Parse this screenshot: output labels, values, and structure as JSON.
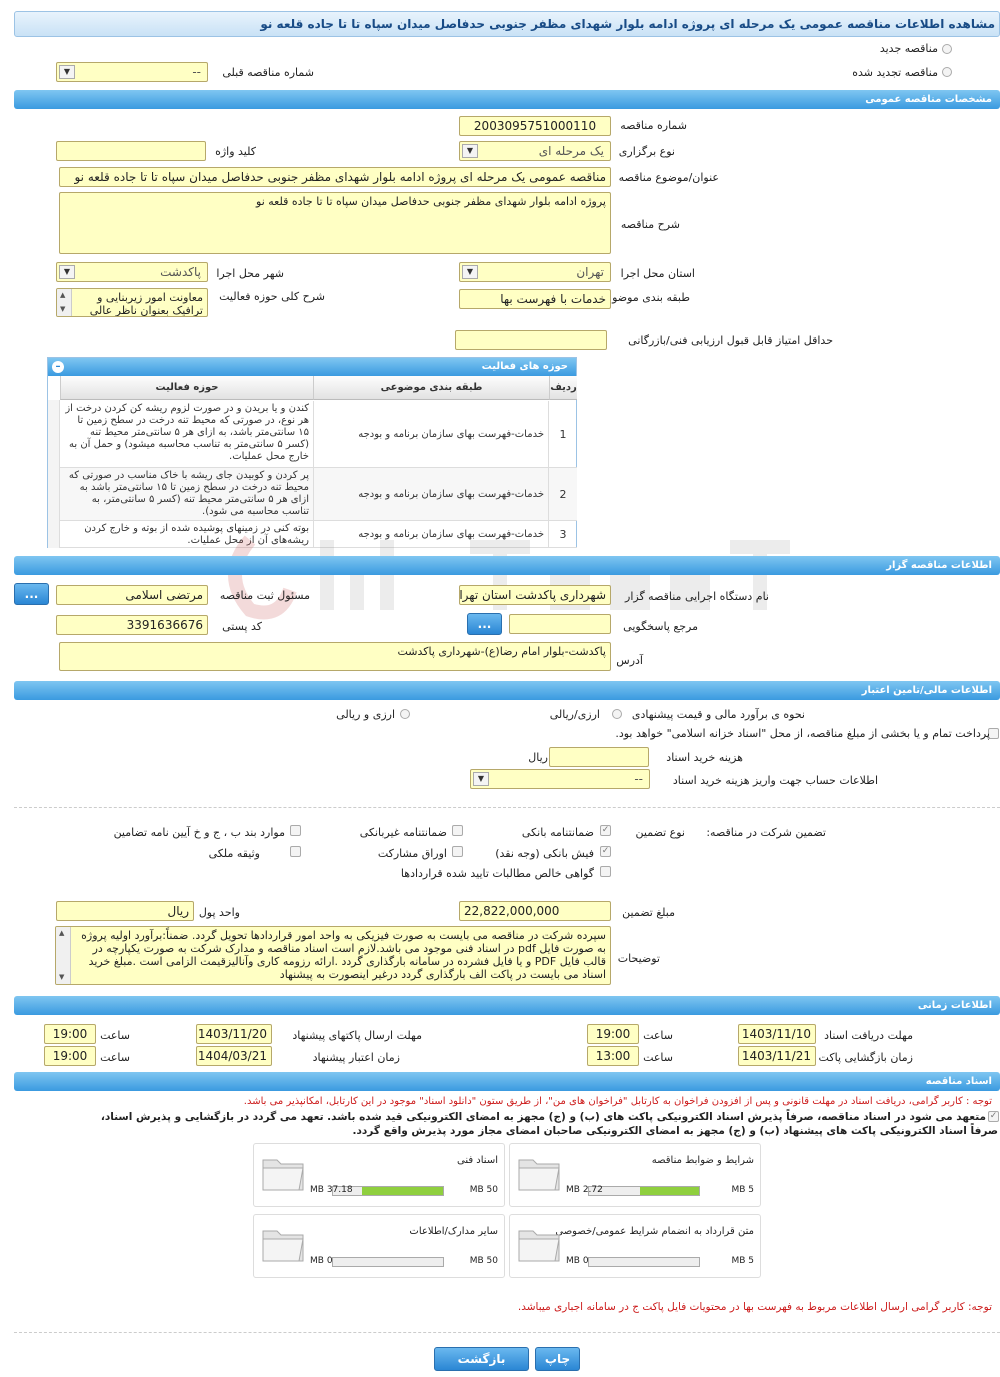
{
  "title": "مشاهده اطلاعات مناقصه عمومی یک مرحله ای پروژه ادامه بلوار شهدای مظفر جنوبی حدفاصل میدان سپاه تا تا جاده قلعه نو",
  "top": {
    "radio_new": "مناقصه جدید",
    "radio_renewed": "مناقصه تجدید شده",
    "prev_tender_label": "شماره مناقصه قبلی",
    "prev_tender_value": "--"
  },
  "general": {
    "header": "مشخصات مناقصه عمومی",
    "number_label": "شماره مناقصه",
    "number_value": "2003095751000110",
    "type_label": "نوع برگزاری",
    "type_value": "یک مرحله ای",
    "keyword_label": "کلید واژه",
    "keyword_value": "",
    "subject_label": "عنوان/موضوع مناقصه",
    "subject_value": "مناقصه عمومی یک مرحله ای پروژه ادامه بلوار شهدای مظفر جنوبی حدفاصل میدان سپاه تا تا جاده قلعه نو",
    "desc_label": "شرح مناقصه",
    "desc_value": "پروژه ادامه بلوار شهدای مظفر جنوبی حدفاصل میدان سپاه تا تا جاده قلعه نو",
    "province_label": "استان محل اجرا",
    "province_value": "تهران",
    "city_label": "شهر محل اجرا",
    "city_value": "پاکدشت",
    "category_label": "طبقه بندی موضوعی",
    "category_value": "خدمات با فهرست بها",
    "activity_desc_label": "شرح کلی حوزه فعالیت",
    "activity_desc_value": "معاونت امور زیربنایی و ترافیک بعنوان ناظر عالی",
    "min_score_label": "حداقل امتیاز قابل قبول ارزیابی فنی/بازرگانی",
    "min_score_value": ""
  },
  "activities": {
    "header": "حوزه های فعالیت",
    "col_row": "ردیف",
    "col_category": "طبقه بندی موضوعی",
    "col_activity": "حوزه فعالیت",
    "rows": [
      {
        "n": "1",
        "cat": "خدمات-فهرست بهای سازمان برنامه و بودجه",
        "act": "کندن و یا بریدن و  در صورت لزوم ریشه کن کردن درخت از هر نوع، در صورتی که محیط تنه درخت در سطح زمین تا ۱۵ سانتی‌متر باشد، به ازای هر ۵ سانتی‌متر محیط تنه (کسر ۵ سانتی‌متر به تناسب محاسبه میشود) و حمل آن به خارج محل عملیات."
      },
      {
        "n": "2",
        "cat": "خدمات-فهرست بهای سازمان برنامه و بودجه",
        "act": "پر کردن و کوبیدن جای ریشه با خاک مناسب در صورتی که محیط تنه درخت در سطح زمین تا ۱۵ سانتی‌متر باشد به ازای هر ۵ سانتی‌متر محیط تنه (کسر ۵ سانتی‌متر، به تناسب محاسبه می شود)."
      },
      {
        "n": "3",
        "cat": "خدمات-فهرست بهای سازمان برنامه و بودجه",
        "act": "بوته کنی در زمینهای پوشیده شده از بوته و خارج کردن ریشه‌های آن از محل عملیات."
      }
    ]
  },
  "organizer": {
    "header": "اطلاعات مناقصه گزار",
    "org_label": "نام دستگاه اجرایی مناقصه گزار",
    "org_value": "شهرداری پاکدشت استان تهران",
    "registrar_label": "مسئول ثبت مناقصه",
    "registrar_value": "مرتضی اسلامی",
    "responder_label": "مرجع پاسخگویی",
    "responder_value": "",
    "postal_label": "کد پستی",
    "postal_value": "3391636676",
    "address_label": "آدرس",
    "address_value": "پاکدشت-بلوار امام رضا(ع)-شهرداری پاکدشت",
    "btn_dots": "..."
  },
  "finance": {
    "header": "اطلاعات مالی/تامین اعتبار",
    "estimate_label": "نحوه ی برآورد مالی و قیمت پیشنهادی",
    "opt_rial": "ارزی/ریالی",
    "opt_rial2": "ریالی",
    "opt_fx": "ارزی و ریالی",
    "islamic_note": "پرداخت تمام و یا بخشی از مبلغ مناقصه، از محل \"اسناد خزانه اسلامی\" خواهد بود.",
    "doc_fee_label": "هزینه خرید اسناد",
    "doc_fee_unit": "ریال",
    "doc_fee_value": "",
    "account_label": "اطلاعات حساب جهت واریز هزینه خرید اسناد",
    "account_value": "--"
  },
  "guarantee": {
    "label": "تضمین شرکت در مناقصه:",
    "type_label": "نوع تضمین",
    "bank_guarantee": "ضمانتنامه بانکی",
    "nonbank_guarantee": "ضمانتنامه غیربانکی",
    "clause_items": "موارد بند ب ، ج و خ آیین نامه تضامین",
    "bank_receipt": "فیش بانکی (وجه نقد)",
    "bonds": "اوراق مشارکت",
    "property": "وثیقه ملکی",
    "claims": "گواهی خالص مطالبات تایید شده قراردادها",
    "amount_label": "مبلغ تضمین",
    "amount_value": "22,822,000,000",
    "currency_label": "واحد پول",
    "currency_value": "ریال",
    "notes_label": "توضیحات",
    "notes_value": "سپرده شرکت در مناقصه می بایست به صورت فیزیکی به واحد امور قراردادها تحویل گردد. ضمناً:برآورد اولیه پروژه به صورت فایل pdf  در اسناد فنی موجود می باشد.لازم است اسناد مناقصه و مدارک شرکت به صورت یکپارچه در قالب فایل PDF  و یا  فایل فشرده در سامانه بارگذاری گردد .ارائه رزومه کاری وآنالیزقیمت الزامی است .مبلغ خرید اسناد می بایست در پاکت الف بارگذاری گردد درغیر اینصورت به پیشنهاد"
  },
  "timing": {
    "header": "اطلاعات زمانی",
    "doc_deadline_label": "مهلت دریافت اسناد",
    "doc_deadline_date": "1403/11/10",
    "doc_deadline_time": "19:00",
    "send_deadline_label": "مهلت ارسال پاکتهای پیشنهاد",
    "send_deadline_date": "1403/11/20",
    "send_deadline_time": "19:00",
    "open_label": "زمان بازگشایی پاکت ها",
    "open_date": "1403/11/21",
    "open_time": "13:00",
    "validity_label": "زمان اعتبار پیشنهاد",
    "validity_date": "1404/03/21",
    "validity_time": "19:00",
    "hour_label": "ساعت"
  },
  "docs": {
    "header": "اسناد مناقصه",
    "note1": "توجه : کاربر گرامی، دریافت اسناد در مهلت قانونی و پس از افزودن فراخوان به کارتابل \"فراخوان های من\"، از طریق ستون \"دانلود اسناد\" موجود در این کارتابل، امکانپذیر می باشد.",
    "commit_line1": "متعهد می شود در اسناد مناقصه، صرفاً پذیرش اسناد الکترونیکی پاکت های (ب) و (ج) مجهز به امضای الکترونیکی قید شده باشد. تعهد می گردد در بازگشایی و پذیرش اسناد،",
    "commit_line2": "صرفاً اسناد الکترونیکی پاکت های پیشنهاد (ب) و (ج) مجهز به امضای الکترونیکی صاحبان امضای مجاز مورد پذیرش واقع گردد.",
    "cards": [
      {
        "title": "شرایط و ضوابط مناقصه",
        "used": "2.72 MB",
        "max": "5 MB",
        "pct": 54
      },
      {
        "title": "اسناد فنی",
        "used": "37.18 MB",
        "max": "50 MB",
        "pct": 74
      },
      {
        "title": "متن قرارداد به انضمام شرایط عمومی/خصوصی",
        "used": "0 MB",
        "max": "5 MB",
        "pct": 0
      },
      {
        "title": "سایر مدارک/اطلاعات",
        "used": "0 MB",
        "max": "50 MB",
        "pct": 0
      }
    ],
    "note2": "توجه: کاربر گرامی ارسال اطلاعات مربوط به فهرست بها در محتویات فایل پاکت ج در سامانه اجباری میباشد."
  },
  "footer": {
    "print": "چاپ",
    "back": "بازگشت"
  },
  "colors": {
    "section": "#3a9ae0",
    "input_bg": "#ffffc4",
    "warning": "#cc1b1b",
    "progress": "#8fcf3e"
  }
}
